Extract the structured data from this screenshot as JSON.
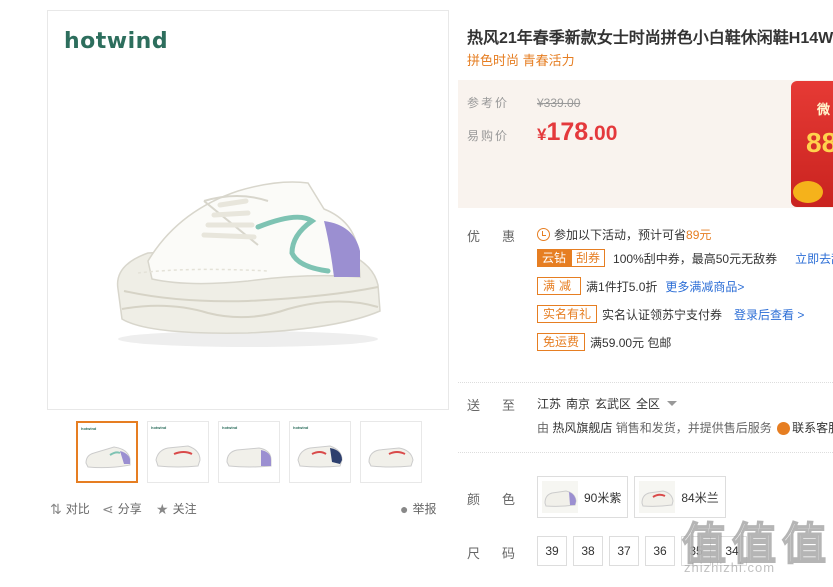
{
  "gallery": {
    "brand_logo": "hotwind",
    "thumb_logo": "hotwind",
    "thumbnails": [
      {
        "accent": "#7ec3b3",
        "back": "#9b8fd1"
      },
      {
        "accent": "#d94a4a",
        "back": "#d94a4a"
      },
      {
        "accent": "#7ec3b3",
        "back": "#9b8fd1"
      },
      {
        "accent": "#2d3f6e",
        "back": "#d94a4a"
      },
      {
        "accent": "#d94a4a",
        "back": "#d94a4a"
      }
    ]
  },
  "tools": {
    "compare_label": "对比",
    "share_label": "分享",
    "follow_label": "关注",
    "report_label": "举报"
  },
  "product": {
    "title": "热风21年春季新款女士时尚拼色小白鞋休闲鞋H14W",
    "subtitle": "拼色时尚 青春活力"
  },
  "price": {
    "ref_label": "参考价",
    "ref_value": "¥339.00",
    "sale_label": "易购价",
    "sale_currency": "¥",
    "sale_int": "178",
    "sale_dec": ".00",
    "banner_small": "微",
    "banner_num": "88"
  },
  "promotions": {
    "label": "优惠",
    "summary_prefix": "参加以下活动，预计可省",
    "summary_amount": "89元",
    "coupon_tag_a": "云钻",
    "coupon_tag_b": "刮券",
    "coupon_text": "100%刮中券，最高50元无敌券",
    "coupon_link": "立即去刮",
    "tag_discount": "满减",
    "discount_text": "满1件打5.0折",
    "discount_link": "更多满减商品>",
    "tag_gift": "实名有礼",
    "gift_text": "实名认证领苏宁支付券",
    "gift_link": "登录后查看 >",
    "tag_shipping": "免运费",
    "shipping_text": "满59.00元 包邮"
  },
  "delivery": {
    "label": "送至",
    "province": "江苏",
    "city": "南京",
    "district": "玄武区",
    "area": "全区",
    "seller_prefix": "由",
    "seller_name": "热风旗舰店",
    "seller_suffix": "销售和发货，并提供售后服务",
    "service_link": "联系客服"
  },
  "colors": {
    "label": "颜色",
    "options": [
      {
        "name": "90米紫",
        "accent": "#9b8fd1"
      },
      {
        "name": "84米兰",
        "accent": "#d94a4a"
      }
    ]
  },
  "sizes": {
    "label": "尺码",
    "options": [
      "39",
      "38",
      "37",
      "36",
      "35",
      "34"
    ]
  },
  "watermark": {
    "chars": [
      "值",
      "值",
      "值"
    ],
    "url": "zhizhizhi.com"
  }
}
